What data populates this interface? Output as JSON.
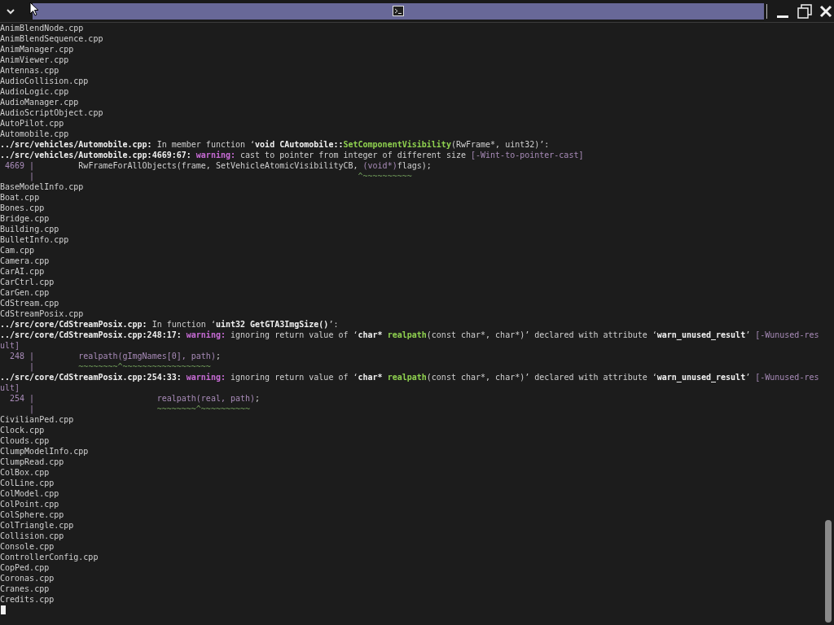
{
  "terminal": {
    "lines": [
      {
        "segments": [
          {
            "text": "AnimBlendNode.cpp",
            "kind": "plain"
          }
        ]
      },
      {
        "segments": [
          {
            "text": "AnimBlendSequence.cpp",
            "kind": "plain"
          }
        ]
      },
      {
        "segments": [
          {
            "text": "AnimManager.cpp",
            "kind": "plain"
          }
        ]
      },
      {
        "segments": [
          {
            "text": "AnimViewer.cpp",
            "kind": "plain"
          }
        ]
      },
      {
        "segments": [
          {
            "text": "Antennas.cpp",
            "kind": "plain"
          }
        ]
      },
      {
        "segments": [
          {
            "text": "AudioCollision.cpp",
            "kind": "plain"
          }
        ]
      },
      {
        "segments": [
          {
            "text": "AudioLogic.cpp",
            "kind": "plain"
          }
        ]
      },
      {
        "segments": [
          {
            "text": "AudioManager.cpp",
            "kind": "plain"
          }
        ]
      },
      {
        "segments": [
          {
            "text": "AudioScriptObject.cpp",
            "kind": "plain"
          }
        ]
      },
      {
        "segments": [
          {
            "text": "AutoPilot.cpp",
            "kind": "plain"
          }
        ]
      },
      {
        "segments": [
          {
            "text": "Automobile.cpp",
            "kind": "plain"
          }
        ]
      },
      {
        "segments": [
          {
            "text": "../src/vehicles/Automobile.cpp:",
            "kind": "bold"
          },
          {
            "text": " In member function ‘",
            "kind": "plain"
          },
          {
            "text": "void CAutomobile::",
            "kind": "bold"
          },
          {
            "text": "SetComponentVisibility",
            "kind": "fn"
          },
          {
            "text": "(RwFrame*, uint32)",
            "kind": "plain"
          },
          {
            "text": "’:",
            "kind": "plain"
          }
        ]
      },
      {
        "segments": [
          {
            "text": "../src/vehicles/Automobile.cpp:4669:67:",
            "kind": "bold"
          },
          {
            "text": " warning:",
            "kind": "warn"
          },
          {
            "text": " cast to pointer from integer of different size ",
            "kind": "plain"
          },
          {
            "text": "[-Wint-to-pointer-cast]",
            "kind": "hint"
          }
        ]
      },
      {
        "segments": [
          {
            "text": " 4669 |",
            "kind": "gutter"
          },
          {
            "text": "         RwFrameForAllObjects(frame, SetVehicleAtomicVisibilityCB, ",
            "kind": "plain"
          },
          {
            "text": "(void*)",
            "kind": "hint"
          },
          {
            "text": "flags);",
            "kind": "plain"
          }
        ]
      },
      {
        "segments": [
          {
            "text": "      |",
            "kind": "gutter"
          },
          {
            "text": "                                                                  ^~~~~~~~~~~",
            "kind": "caret"
          }
        ]
      },
      {
        "segments": [
          {
            "text": "BaseModelInfo.cpp",
            "kind": "plain"
          }
        ]
      },
      {
        "segments": [
          {
            "text": "Boat.cpp",
            "kind": "plain"
          }
        ]
      },
      {
        "segments": [
          {
            "text": "Bones.cpp",
            "kind": "plain"
          }
        ]
      },
      {
        "segments": [
          {
            "text": "Bridge.cpp",
            "kind": "plain"
          }
        ]
      },
      {
        "segments": [
          {
            "text": "Building.cpp",
            "kind": "plain"
          }
        ]
      },
      {
        "segments": [
          {
            "text": "BulletInfo.cpp",
            "kind": "plain"
          }
        ]
      },
      {
        "segments": [
          {
            "text": "Cam.cpp",
            "kind": "plain"
          }
        ]
      },
      {
        "segments": [
          {
            "text": "Camera.cpp",
            "kind": "plain"
          }
        ]
      },
      {
        "segments": [
          {
            "text": "CarAI.cpp",
            "kind": "plain"
          }
        ]
      },
      {
        "segments": [
          {
            "text": "CarCtrl.cpp",
            "kind": "plain"
          }
        ]
      },
      {
        "segments": [
          {
            "text": "CarGen.cpp",
            "kind": "plain"
          }
        ]
      },
      {
        "segments": [
          {
            "text": "CdStream.cpp",
            "kind": "plain"
          }
        ]
      },
      {
        "segments": [
          {
            "text": "CdStreamPosix.cpp",
            "kind": "plain"
          }
        ]
      },
      {
        "segments": [
          {
            "text": "../src/core/CdStreamPosix.cpp:",
            "kind": "bold"
          },
          {
            "text": " In function ‘",
            "kind": "plain"
          },
          {
            "text": "uint32 GetGTA3ImgSize()",
            "kind": "bold"
          },
          {
            "text": "’:",
            "kind": "plain"
          }
        ]
      },
      {
        "segments": [
          {
            "text": "../src/core/CdStreamPosix.cpp:248:17:",
            "kind": "bold"
          },
          {
            "text": " warning:",
            "kind": "warn"
          },
          {
            "text": " ignoring return value of ‘",
            "kind": "plain"
          },
          {
            "text": "char* ",
            "kind": "bold"
          },
          {
            "text": "realpath",
            "kind": "fn"
          },
          {
            "text": "(const char*, char*)’ declared with attribute ‘",
            "kind": "plain"
          },
          {
            "text": "warn_unused_result",
            "kind": "bold"
          },
          {
            "text": "’ ",
            "kind": "plain"
          },
          {
            "text": "[-Wunused-res",
            "kind": "hint"
          }
        ]
      },
      {
        "segments": [
          {
            "text": "ult]",
            "kind": "hint"
          }
        ]
      },
      {
        "segments": [
          {
            "text": "  248 |         ",
            "kind": "gutter"
          },
          {
            "text": "realpath(gImgNames[0], path)",
            "kind": "hint"
          },
          {
            "text": ";",
            "kind": "plain"
          }
        ]
      },
      {
        "segments": [
          {
            "text": "      |",
            "kind": "gutter"
          },
          {
            "text": "         ~~~~~~~~^~~~~~~~~~~~~~~~~~~",
            "kind": "caret"
          }
        ]
      },
      {
        "segments": [
          {
            "text": "../src/core/CdStreamPosix.cpp:254:33:",
            "kind": "bold"
          },
          {
            "text": " warning:",
            "kind": "warn"
          },
          {
            "text": " ignoring return value of ‘",
            "kind": "plain"
          },
          {
            "text": "char* ",
            "kind": "bold"
          },
          {
            "text": "realpath",
            "kind": "fn"
          },
          {
            "text": "(const char*, char*)’ declared with attribute ‘",
            "kind": "plain"
          },
          {
            "text": "warn_unused_result",
            "kind": "bold"
          },
          {
            "text": "’ ",
            "kind": "plain"
          },
          {
            "text": "[-Wunused-res",
            "kind": "hint"
          }
        ]
      },
      {
        "segments": [
          {
            "text": "ult]",
            "kind": "hint"
          }
        ]
      },
      {
        "segments": [
          {
            "text": "  254 |                         ",
            "kind": "gutter"
          },
          {
            "text": "realpath(real, path)",
            "kind": "hint"
          },
          {
            "text": ";",
            "kind": "plain"
          }
        ]
      },
      {
        "segments": [
          {
            "text": "      |",
            "kind": "gutter"
          },
          {
            "text": "                         ~~~~~~~~^~~~~~~~~~~",
            "kind": "caret"
          }
        ]
      },
      {
        "segments": [
          {
            "text": "CivilianPed.cpp",
            "kind": "plain"
          }
        ]
      },
      {
        "segments": [
          {
            "text": "Clock.cpp",
            "kind": "plain"
          }
        ]
      },
      {
        "segments": [
          {
            "text": "Clouds.cpp",
            "kind": "plain"
          }
        ]
      },
      {
        "segments": [
          {
            "text": "ClumpModelInfo.cpp",
            "kind": "plain"
          }
        ]
      },
      {
        "segments": [
          {
            "text": "ClumpRead.cpp",
            "kind": "plain"
          }
        ]
      },
      {
        "segments": [
          {
            "text": "ColBox.cpp",
            "kind": "plain"
          }
        ]
      },
      {
        "segments": [
          {
            "text": "ColLine.cpp",
            "kind": "plain"
          }
        ]
      },
      {
        "segments": [
          {
            "text": "ColModel.cpp",
            "kind": "plain"
          }
        ]
      },
      {
        "segments": [
          {
            "text": "ColPoint.cpp",
            "kind": "plain"
          }
        ]
      },
      {
        "segments": [
          {
            "text": "ColSphere.cpp",
            "kind": "plain"
          }
        ]
      },
      {
        "segments": [
          {
            "text": "ColTriangle.cpp",
            "kind": "plain"
          }
        ]
      },
      {
        "segments": [
          {
            "text": "Collision.cpp",
            "kind": "plain"
          }
        ]
      },
      {
        "segments": [
          {
            "text": "Console.cpp",
            "kind": "plain"
          }
        ]
      },
      {
        "segments": [
          {
            "text": "ControllerConfig.cpp",
            "kind": "plain"
          }
        ]
      },
      {
        "segments": [
          {
            "text": "CopPed.cpp",
            "kind": "plain"
          }
        ]
      },
      {
        "segments": [
          {
            "text": "Coronas.cpp",
            "kind": "plain"
          }
        ]
      },
      {
        "segments": [
          {
            "text": "Cranes.cpp",
            "kind": "plain"
          }
        ]
      },
      {
        "segments": [
          {
            "text": "Credits.cpp",
            "kind": "plain"
          }
        ]
      }
    ]
  }
}
